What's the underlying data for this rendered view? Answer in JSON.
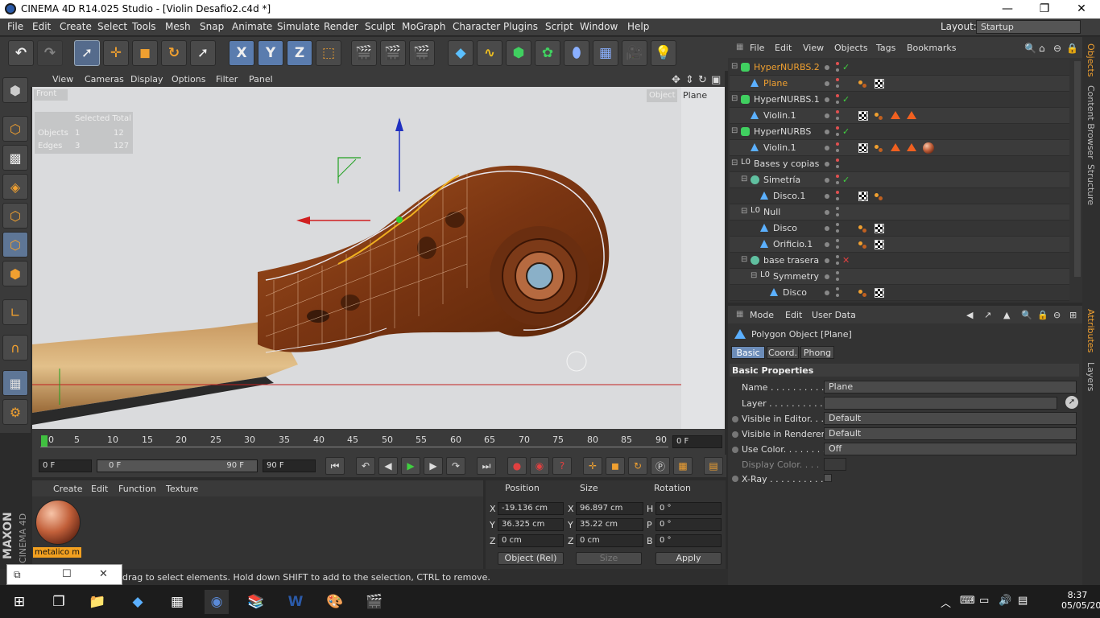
{
  "window": {
    "title": "CINEMA 4D R14.025 Studio - [Violin Desafio2.c4d *]"
  },
  "menu": [
    "File",
    "Edit",
    "Create",
    "Select",
    "Tools",
    "Mesh",
    "Snap",
    "Animate",
    "Simulate",
    "Render",
    "Sculpt",
    "MoGraph",
    "Character",
    "Plugins",
    "Script",
    "Window",
    "Help"
  ],
  "layout": {
    "label": "Layout:",
    "value": "Startup"
  },
  "viewport": {
    "menu": [
      "View",
      "Cameras",
      "Display",
      "Options",
      "Filter",
      "Panel"
    ],
    "view_name": "Front",
    "object_tab": "Object",
    "plane_tab": "Plane",
    "hud": {
      "header": "Selected Total",
      "rows": [
        {
          "label": "Objects",
          "selected": "1",
          "total": "12"
        },
        {
          "label": "Edges",
          "selected": "3",
          "total": "127"
        }
      ]
    }
  },
  "timeline": {
    "ticks": [
      "0",
      "5",
      "10",
      "15",
      "20",
      "25",
      "30",
      "35",
      "40",
      "45",
      "50",
      "55",
      "60",
      "65",
      "70",
      "75",
      "80",
      "85",
      "90"
    ],
    "current_frame": "0 F",
    "start": "0 F",
    "range_start": "0 F",
    "range_end": "90 F",
    "end": "90 F"
  },
  "materials": {
    "menu": [
      "Create",
      "Edit",
      "Function",
      "Texture"
    ],
    "item": "metalico m"
  },
  "coords": {
    "headers": [
      "Position",
      "Size",
      "Rotation"
    ],
    "rows": [
      {
        "a": "X",
        "pos": "-19.136 cm",
        "b": "X",
        "size": "96.897 cm",
        "c": "H",
        "rot": "0 °"
      },
      {
        "a": "Y",
        "pos": "36.325 cm",
        "b": "Y",
        "size": "35.22 cm",
        "c": "P",
        "rot": "0 °"
      },
      {
        "a": "Z",
        "pos": "0 cm",
        "b": "Z",
        "size": "0 cm",
        "c": "B",
        "rot": "0 °"
      }
    ],
    "mode": "Object (Rel)",
    "size_mode": "Size",
    "apply": "Apply"
  },
  "status": {
    "text": "drag to select elements. Hold down SHIFT to add to the selection, CTRL to remove."
  },
  "objects": {
    "menu": [
      "File",
      "Edit",
      "View",
      "Objects",
      "Tags",
      "Bookmarks"
    ],
    "rows": [
      {
        "name": "HyperNURBS.2",
        "type": "nurbs",
        "indent": 0,
        "active": true
      },
      {
        "name": "Plane",
        "type": "poly",
        "indent": 1,
        "active": true,
        "selected": true
      },
      {
        "name": "HyperNURBS.1",
        "type": "nurbs",
        "indent": 0
      },
      {
        "name": "Violin.1",
        "type": "poly",
        "indent": 1
      },
      {
        "name": "HyperNURBS",
        "type": "nurbs",
        "indent": 0
      },
      {
        "name": "Violin.1",
        "type": "poly",
        "indent": 1
      },
      {
        "name": "Bases y copias",
        "type": "null",
        "indent": 0
      },
      {
        "name": "Simetría",
        "type": "sym",
        "indent": 1
      },
      {
        "name": "Disco.1",
        "type": "poly",
        "indent": 2
      },
      {
        "name": "Null",
        "type": "null",
        "indent": 1
      },
      {
        "name": "Disco",
        "type": "poly",
        "indent": 2
      },
      {
        "name": "Orificio.1",
        "type": "poly",
        "indent": 2
      },
      {
        "name": "base trasera",
        "type": "sym",
        "indent": 1
      },
      {
        "name": "Symmetry",
        "type": "null",
        "indent": 2
      },
      {
        "name": "Disco",
        "type": "poly",
        "indent": 3
      }
    ]
  },
  "attributes": {
    "menu": [
      "Mode",
      "Edit",
      "User Data"
    ],
    "object": "Polygon Object [Plane]",
    "tabs": [
      "Basic",
      "Coord.",
      "Phong"
    ],
    "section": "Basic Properties",
    "fields": [
      {
        "label": "Name . . . . . . . . . . . .",
        "value": "Plane"
      },
      {
        "label": "Layer . . . . . . . . . . . .",
        "value": ""
      },
      {
        "label": "Visible in Editor. . .",
        "value": "Default"
      },
      {
        "label": "Visible in Renderer",
        "value": "Default"
      },
      {
        "label": "Use Color. . . . . . . .",
        "value": "Off"
      },
      {
        "label": "Display Color. . . .",
        "value": ""
      },
      {
        "label": "X-Ray . . . . . . . . . . .",
        "value": ""
      }
    ]
  },
  "sidetabs": [
    "Objects",
    "Content Browser",
    "Structure",
    "Attributes",
    "Layers"
  ],
  "taskbar": {
    "time": "8:37",
    "date": "05/05/2016"
  },
  "maxon": {
    "brand": "MAXON",
    "product": "CINEMA 4D"
  }
}
